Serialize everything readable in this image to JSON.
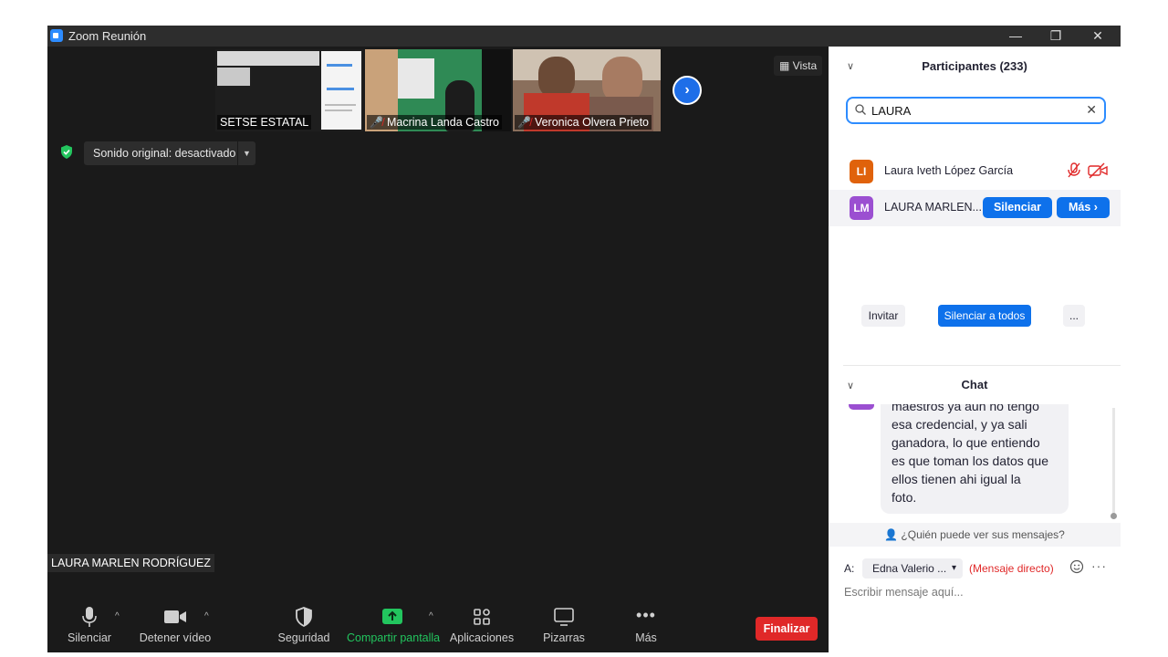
{
  "window": {
    "title": "Zoom Reunión",
    "controls": {
      "minimize": "—",
      "restore": "❐",
      "close": "✕"
    }
  },
  "video": {
    "thumbnails": [
      {
        "name": "SETSE ESTATAL",
        "muted": false
      },
      {
        "name": "Macrina Landa Castro",
        "muted": true
      },
      {
        "name": "Veronica Olvera Prieto",
        "muted": true
      }
    ],
    "view_label": "Vista",
    "sound_label": "Sonido original: desactivado",
    "active_speaker": "LAURA MARLEN RODRÍGUEZ"
  },
  "toolbar": {
    "mute": "Silenciar",
    "video": "Detener vídeo",
    "security": "Seguridad",
    "share": "Compartir pantalla",
    "apps": "Aplicaciones",
    "whiteboards": "Pizarras",
    "more": "Más",
    "end": "Finalizar"
  },
  "participants": {
    "header": "Participantes (233)",
    "search_value": "LAURA",
    "rows": [
      {
        "initials": "LI",
        "name": "Laura Iveth López García",
        "color": "#e0620b"
      },
      {
        "initials": "LM",
        "name": "LAURA MARLEN...",
        "color": "#9b4fd1"
      }
    ],
    "row_buttons": {
      "mute": "Silenciar",
      "more": "Más ›"
    },
    "actions": {
      "invite": "Invitar",
      "mute_all": "Silenciar a todos",
      "more": "..."
    }
  },
  "chat": {
    "header": "Chat",
    "message_lines": [
      "maestros ya aun no tengo",
      "esa credencial, y ya sali",
      "ganadora, lo que entiendo",
      "es que toman los datos que",
      "ellos tienen ahi igual la",
      "foto."
    ],
    "who_can_see": "¿Quién puede ver sus mensajes?",
    "to_label": "A:",
    "recipient": "Edna Valerio ...",
    "direct_label": "(Mensaje directo)",
    "compose_placeholder": "Escribir mensaje aquí..."
  },
  "colors": {
    "accent": "#0e71eb",
    "end_red": "#e02828",
    "share_green": "#22c55e"
  }
}
